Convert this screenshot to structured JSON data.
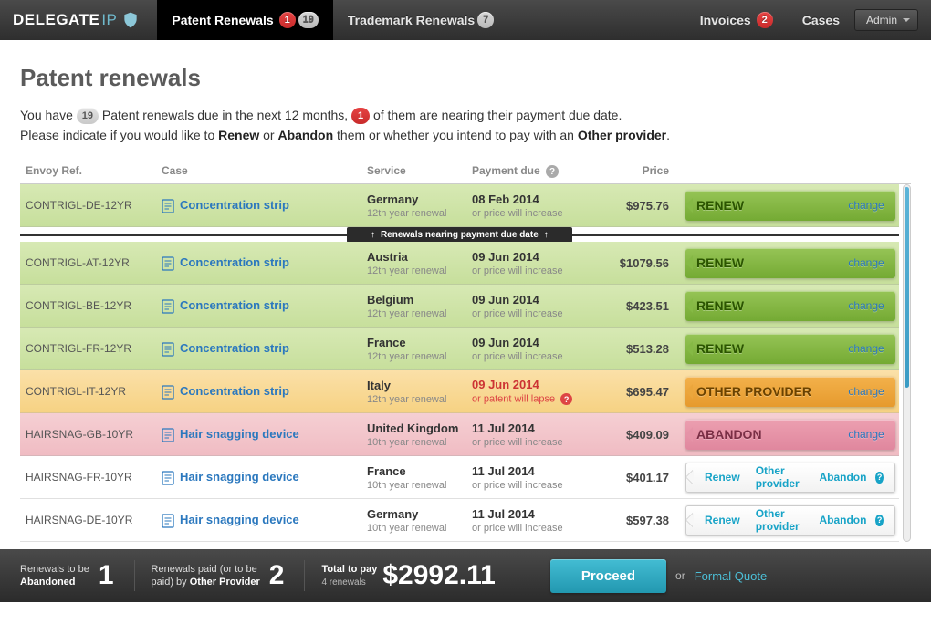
{
  "brand": {
    "name": "DELEGATE",
    "suffix": "IP"
  },
  "nav": {
    "patent": {
      "label": "Patent Renewals",
      "urgent": "1",
      "count": "19"
    },
    "trademark": {
      "label": "Trademark Renewals",
      "count": "7"
    },
    "invoices": {
      "label": "Invoices",
      "count": "2"
    },
    "cases": {
      "label": "Cases"
    },
    "admin": {
      "label": "Admin"
    }
  },
  "page": {
    "title": "Patent renewals",
    "intro1a": "You have ",
    "intro1_count": "19",
    "intro1b": " Patent renewals due in the next 12 months, ",
    "intro1_urgent": "1",
    "intro1c": " of them are nearing their payment due date.",
    "intro2a": "Please indicate if you would like to ",
    "intro2_renew": "Renew",
    "intro2b": " or ",
    "intro2_abandon": "Abandon",
    "intro2c": " them or whether you intend to pay with an ",
    "intro2_other": "Other provider",
    "intro2d": "."
  },
  "headers": {
    "ref": "Envoy Ref.",
    "case": "Case",
    "service": "Service",
    "due": "Payment due",
    "price": "Price"
  },
  "divider": "Renewals nearing payment due date",
  "actions": {
    "renew": "RENEW",
    "other": "OTHER PROVIDER",
    "abandon": "ABANDON",
    "change": "change",
    "opt_renew": "Renew",
    "opt_other": "Other provider",
    "opt_abandon": "Abandon"
  },
  "rows": [
    {
      "ref": "CONTRIGL-DE-12YR",
      "case": "Concentration strip",
      "country": "Germany",
      "sub": "12th year renewal",
      "due": "08 Feb 2014",
      "duesub": "or price will increase",
      "price": "$975.76",
      "kind": "renew"
    },
    {
      "ref": "CONTRIGL-AT-12YR",
      "case": "Concentration strip",
      "country": "Austria",
      "sub": "12th year renewal",
      "due": "09 Jun 2014",
      "duesub": "or price will increase",
      "price": "$1079.56",
      "kind": "renew"
    },
    {
      "ref": "CONTRIGL-BE-12YR",
      "case": "Concentration strip",
      "country": "Belgium",
      "sub": "12th year renewal",
      "due": "09 Jun 2014",
      "duesub": "or price will increase",
      "price": "$423.51",
      "kind": "renew"
    },
    {
      "ref": "CONTRIGL-FR-12YR",
      "case": "Concentration strip",
      "country": "France",
      "sub": "12th year renewal",
      "due": "09 Jun 2014",
      "duesub": "or price will increase",
      "price": "$513.28",
      "kind": "renew"
    },
    {
      "ref": "CONTRIGL-IT-12YR",
      "case": "Concentration strip",
      "country": "Italy",
      "sub": "12th year renewal",
      "due": "09 Jun 2014",
      "duesub": "or patent will lapse",
      "price": "$695.47",
      "kind": "other",
      "urgent": true
    },
    {
      "ref": "HAIRSNAG-GB-10YR",
      "case": "Hair snagging device",
      "country": "United Kingdom",
      "sub": "10th year renewal",
      "due": "11 Jul 2014",
      "duesub": "or price will increase",
      "price": "$409.09",
      "kind": "abandon"
    },
    {
      "ref": "HAIRSNAG-FR-10YR",
      "case": "Hair snagging device",
      "country": "France",
      "sub": "10th year renewal",
      "due": "11 Jul 2014",
      "duesub": "or price will increase",
      "price": "$401.17",
      "kind": "blank"
    },
    {
      "ref": "HAIRSNAG-DE-10YR",
      "case": "Hair snagging device",
      "country": "Germany",
      "sub": "10th year renewal",
      "due": "11 Jul 2014",
      "duesub": "or price will increase",
      "price": "$597.38",
      "kind": "blank"
    }
  ],
  "footer": {
    "ab_label_a": "Renewals to be",
    "ab_label_b": "Abandoned",
    "ab_num": "1",
    "op_label_a": "Renewals paid (or to be",
    "op_label_b": "paid) by ",
    "op_label_c": "Other Provider",
    "op_num": "2",
    "tot_label": "Total to pay",
    "tot_sub": "4 renewals",
    "tot_amt": "$2992.11",
    "proceed": "Proceed",
    "or": "or",
    "fq": "Formal Quote"
  }
}
